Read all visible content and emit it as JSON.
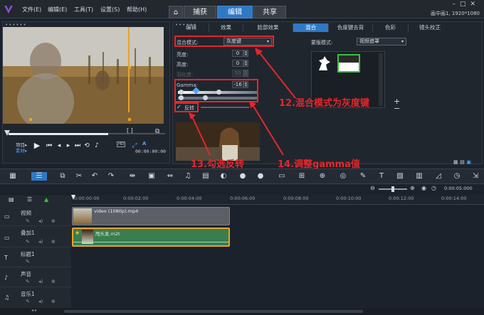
{
  "menu": {
    "file": "文件(E)",
    "edit": "编辑(E)",
    "tools": "工具(T)",
    "settings": "设置(S)",
    "help": "帮助(H)"
  },
  "main_tabs": {
    "capture": "捕获",
    "edit": "编辑",
    "share": "共享"
  },
  "resolution": "画中画1, 1920*1080",
  "preview": {
    "project_label": "项目▸",
    "clip_label": "素材▸",
    "hd_badge": "HD",
    "timecode": "00:00:00:00",
    "bracket_label": "[ ]"
  },
  "option_tabs": [
    "编辑",
    "效果",
    "脸部效果",
    "混合",
    "色度键去背",
    "色彩",
    "镜头校正"
  ],
  "active_option_tab": "混合",
  "blend": {
    "mode_label": "混合模式:",
    "mode_value": "灰度键",
    "brightness_label": "亮度:",
    "brightness_value": "0",
    "height_label": "高度:",
    "height_value": "0",
    "feather_label": "羽化度:",
    "feather_value": "50",
    "gamma_label": "Gamma:",
    "gamma_value": "-16",
    "invert_label": "反转",
    "invert_checked": true,
    "mask_mode_label": "蒙版模式:",
    "mask_mode_value": "视频遮罩"
  },
  "annotations": {
    "a12": "12.混合模式为灰度键",
    "a13": "13.勾选反转",
    "a14": "14.调整gamma值"
  },
  "timeline": {
    "zoom_time": "0:00:05:000",
    "ruler": [
      "0:00:00:00",
      "0:00:02:00",
      "0:00:04:00",
      "0:00:06:00",
      "0:00:08:00",
      "0:00:10:00",
      "0:00:12:00",
      "0:00:14:00"
    ],
    "tracks": [
      {
        "label": "视频"
      },
      {
        "label": "叠加1"
      },
      {
        "label": "标题1"
      },
      {
        "label": "声音"
      },
      {
        "label": "音乐1"
      }
    ],
    "clips": {
      "video": "video (1080p).mp4",
      "overlay": "甩头发.m2t"
    }
  },
  "colors": {
    "accent": "#2f79c4",
    "annotation": "#e5262b",
    "overlay_clip": "#3a7d4f",
    "video_clip": "#5c5f66"
  }
}
